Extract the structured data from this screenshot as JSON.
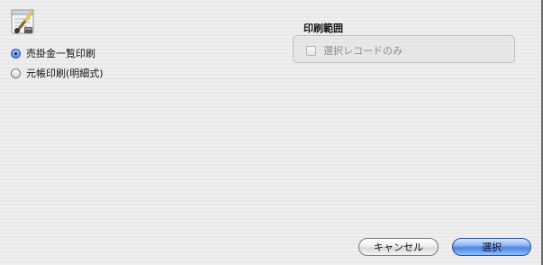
{
  "dialog": {
    "app_icon": "paintbrush-icon"
  },
  "print_mode": {
    "options": [
      {
        "label": "売掛金一覧印刷",
        "selected": true
      },
      {
        "label": "元帳印刷(明細式)",
        "selected": false
      }
    ]
  },
  "print_range": {
    "title": "印刷範囲",
    "selected_records_only": {
      "label": "選択レコードのみ",
      "checked": false,
      "enabled": false
    }
  },
  "buttons": {
    "cancel_label": "キャンセル",
    "select_label": "選択"
  },
  "colors": {
    "default_button": "#5b8fe4",
    "radio_selected": "#3a62b8"
  }
}
